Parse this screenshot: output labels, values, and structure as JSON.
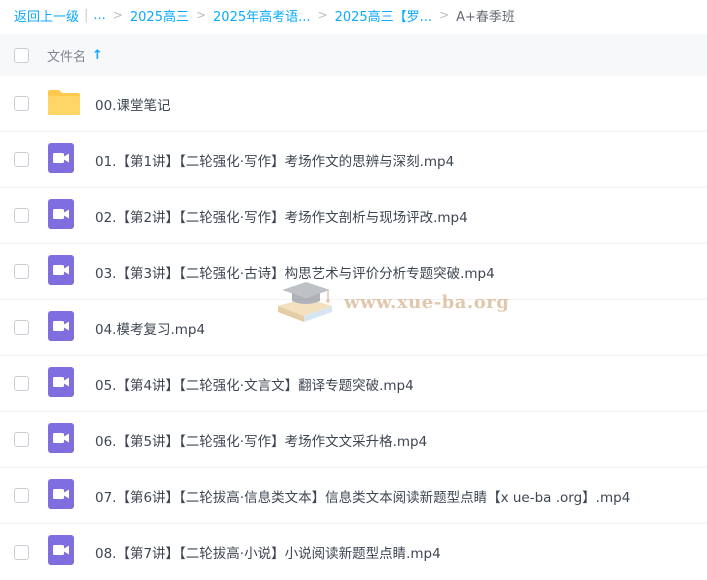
{
  "breadcrumb": {
    "back_label": "返回上一级",
    "ellipsis": "...",
    "items": [
      "2025高三",
      "2025年高考语...",
      "2025高三【罗..."
    ],
    "current": "A+春季班"
  },
  "list_header": {
    "column_label": "文件名",
    "sort_arrow": "↑"
  },
  "files": [
    {
      "name": "00.课堂笔记",
      "icon": "folder-icon"
    },
    {
      "name": "01.【第1讲】【二轮强化·写作】考场作文的思辨与深刻.mp4",
      "icon": "video-file-icon"
    },
    {
      "name": "02.【第2讲】【二轮强化·写作】考场作文剖析与现场评改.mp4",
      "icon": "video-file-icon"
    },
    {
      "name": "03.【第3讲】【二轮强化·古诗】构思艺术与评价分析专题突破.mp4",
      "icon": "video-file-icon"
    },
    {
      "name": "04.模考复习.mp4",
      "icon": "video-file-icon"
    },
    {
      "name": "05.【第4讲】【二轮强化·文言文】翻译专题突破.mp4",
      "icon": "video-file-icon"
    },
    {
      "name": "06.【第5讲】【二轮强化·写作】考场作文文采升格.mp4",
      "icon": "video-file-icon"
    },
    {
      "name": "07.【第6讲】【二轮拔高·信息类文本】信息类文本阅读新题型点睛【x ue-ba .org】.mp4",
      "icon": "video-file-icon"
    },
    {
      "name": "08.【第7讲】【二轮拔高·小说】小说阅读新题型点睛.mp4",
      "icon": "video-file-icon"
    }
  ],
  "watermark": {
    "text": "www.xue-ba.org"
  },
  "colors": {
    "accent": "#09aaff",
    "folder": "#ffc94d",
    "video": "#7e6ee0"
  }
}
